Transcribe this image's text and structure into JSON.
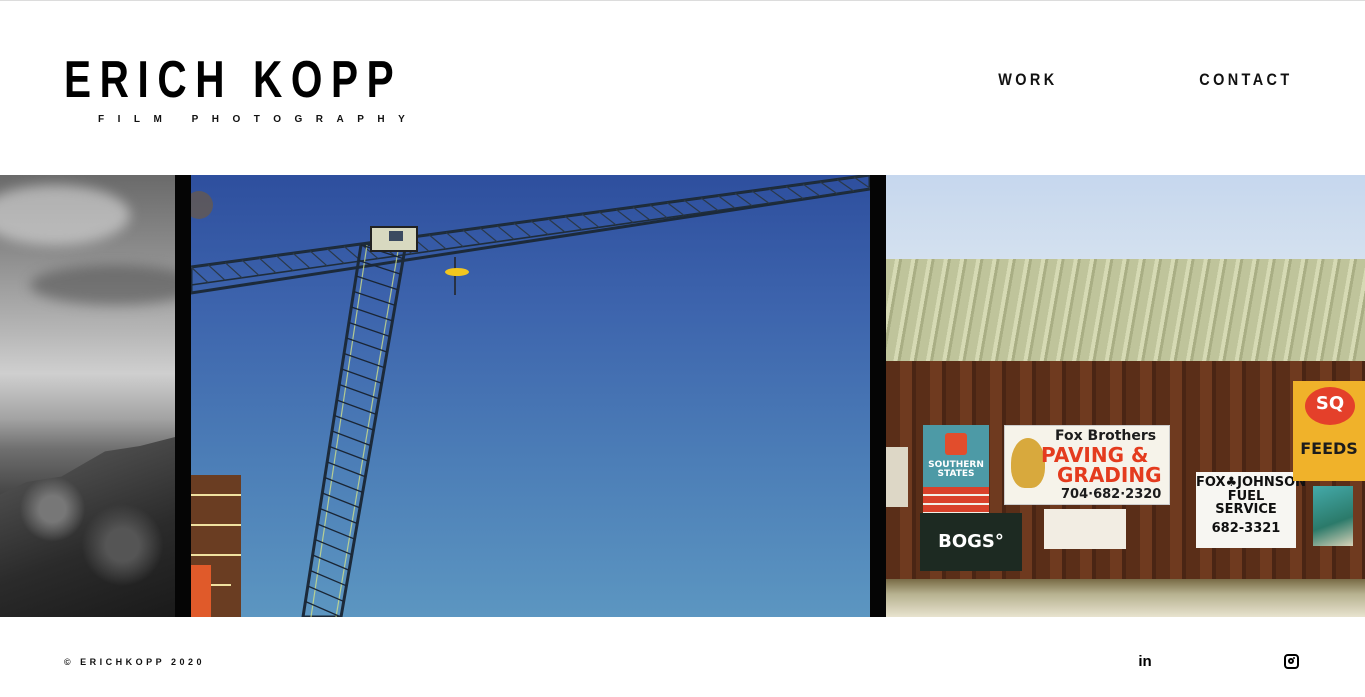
{
  "header": {
    "site_name": "ERICH KOPP",
    "tagline": "FILM PHOTOGRAPHY",
    "nav": [
      {
        "label": "WORK"
      },
      {
        "label": "CONTACT"
      }
    ]
  },
  "gallery": {
    "photos": [
      {
        "icon": "bw-mountain-photo"
      },
      {
        "icon": "crane-photo"
      },
      {
        "icon": "barn-signs-photo"
      }
    ],
    "barn_signs": {
      "southern": "SOUTHERN STATES",
      "fox_line1": "Fox Brothers",
      "fox_line2": "PAVING &",
      "fox_line3": "GRADING",
      "fox_phone": "704·682·2320",
      "bogs": "BOGS°",
      "johnson_line1": "FOX♣JOHNSON",
      "johnson_line2": "FUEL SERVICE",
      "johnson_phone": "682-3321",
      "sq_logo": "SQ",
      "sq_label": "FEEDS"
    }
  },
  "footer": {
    "copyright": "© ERICHKOPP 2020",
    "social": [
      {
        "icon": "linkedin-icon",
        "glyph": "in"
      },
      {
        "icon": "instagram-icon"
      }
    ]
  }
}
